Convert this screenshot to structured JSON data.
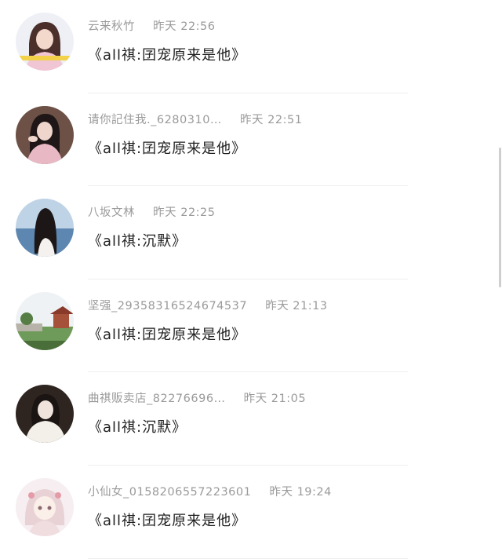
{
  "comments": [
    {
      "name": "云来秋竹",
      "time": "昨天 22:56",
      "message": "《all祺:囝宠原来是他》",
      "avatar_icon": "girl-portrait-avatar"
    },
    {
      "name": "请你記住我._6280310…",
      "time": "昨天 22:51",
      "message": "《all祺:囝宠原来是他》",
      "avatar_icon": "girl-portrait-avatar"
    },
    {
      "name": "八坂文林",
      "time": "昨天 22:25",
      "message": "《all祺:沉默》",
      "avatar_icon": "girl-seaside-avatar"
    },
    {
      "name": "坚强_29358316524674537",
      "time": "昨天 21:13",
      "message": "《all祺:囝宠原来是他》",
      "avatar_icon": "garden-pavilion-avatar"
    },
    {
      "name": "曲祺贩卖店_82276696…",
      "time": "昨天 21:05",
      "message": "《all祺:沉默》",
      "avatar_icon": "girl-portrait-avatar"
    },
    {
      "name": "小仙女_0158206557223601",
      "time": "昨天 19:24",
      "message": "《all祺:囝宠原来是他》",
      "avatar_icon": "anime-girl-avatar"
    }
  ]
}
